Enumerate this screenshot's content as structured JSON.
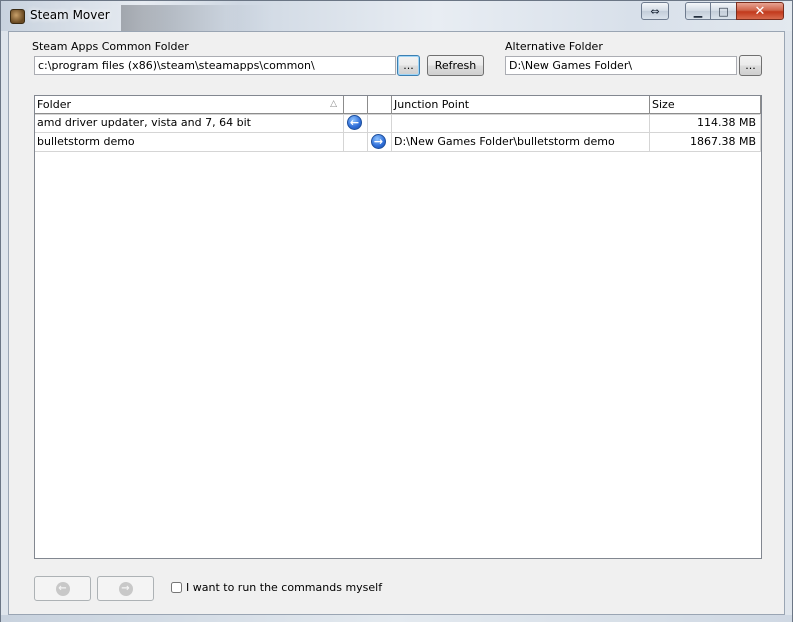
{
  "window": {
    "title": "Steam Mover",
    "controls": {
      "swap": "⇔",
      "minimize": "▁",
      "maximize": "□",
      "close": "✕"
    }
  },
  "common_folder": {
    "label": "Steam Apps Common Folder",
    "value": "c:\\program files (x86)\\steam\\steamapps\\common\\",
    "browse_label": "...",
    "refresh_label": "Refresh"
  },
  "alternative_folder": {
    "label": "Alternative Folder",
    "value": "D:\\New Games Folder\\",
    "browse_label": "..."
  },
  "list": {
    "columns": {
      "folder": "Folder",
      "col2": "",
      "col3": "",
      "junction": "Junction Point",
      "size": "Size"
    },
    "sort_indicator": "△",
    "rows": [
      {
        "folder": "amd driver updater, vista and 7, 64 bit",
        "move_left_icon": "arrow-left-circle-icon",
        "move_right_icon": "",
        "junction": "",
        "size": "114.38 MB"
      },
      {
        "folder": "bulletstorm demo",
        "move_left_icon": "",
        "move_right_icon": "arrow-right-circle-icon",
        "junction": "D:\\New Games Folder\\bulletstorm demo",
        "size": "1867.38 MB"
      }
    ]
  },
  "bottom": {
    "back_icon": "arrow-left-circle-icon",
    "forward_icon": "arrow-right-circle-icon",
    "run_commands_label": "I want to run the commands myself",
    "run_commands_checked": false
  },
  "icons": {
    "left_arrow_glyph": "←",
    "right_arrow_glyph": "→"
  },
  "colors": {
    "accent_blue": "#2f6ed8",
    "close_red": "#c2391c"
  }
}
